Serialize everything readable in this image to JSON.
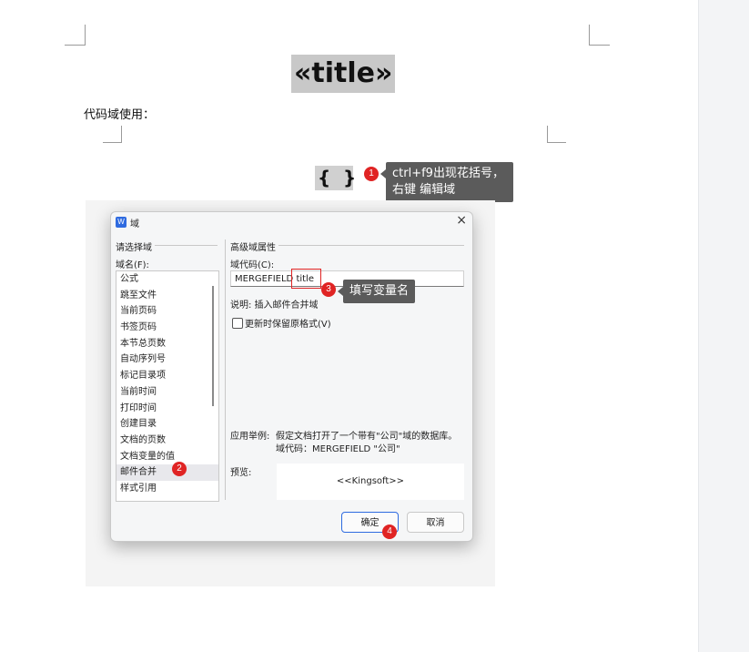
{
  "document": {
    "title_field": "«title»",
    "line_text": "代码域使用：",
    "braces_left": "{",
    "braces_right": "}"
  },
  "annotations": [
    {
      "number": "1",
      "text_line1": "ctrl+f9出现花括号，",
      "text_line2": "右键 编辑域"
    },
    {
      "number": "2"
    },
    {
      "number": "3",
      "text": "填写变量名"
    },
    {
      "number": "4"
    }
  ],
  "dialog": {
    "icon_letter": "W",
    "title": "域",
    "close_glyph": "×",
    "choose_field_label": "请选择域",
    "field_name_label": "域名(F):",
    "field_list": [
      "公式",
      "跳至文件",
      "当前页码",
      "书签页码",
      "本节总页数",
      "自动序列号",
      "标记目录项",
      "当前时间",
      "打印时间",
      "创建目录",
      "文档的页数",
      "文档变量的值",
      "邮件合并",
      "样式引用"
    ],
    "selected_field": "邮件合并",
    "advanced_label": "高级域属性",
    "field_code_label": "域代码(C):",
    "field_code_prefix": "MERGEFIELD ",
    "field_code_var": "title",
    "description": "说明: 插入邮件合并域",
    "checkbox_label": "更新时保留原格式(V)",
    "example_label": "应用举例:",
    "example_line1": "假定文档打开了一个带有\"公司\"域的数据库。",
    "example_line2": "域代码：MERGEFIELD \"公司\"",
    "preview_label": "预览:",
    "preview_text": "<<Kingsoft>>",
    "ok_label": "确定",
    "cancel_label": "取消"
  },
  "colors": {
    "badge": "#e02424",
    "tooltip": "#5b5b5b",
    "accent": "#2f6be0"
  }
}
